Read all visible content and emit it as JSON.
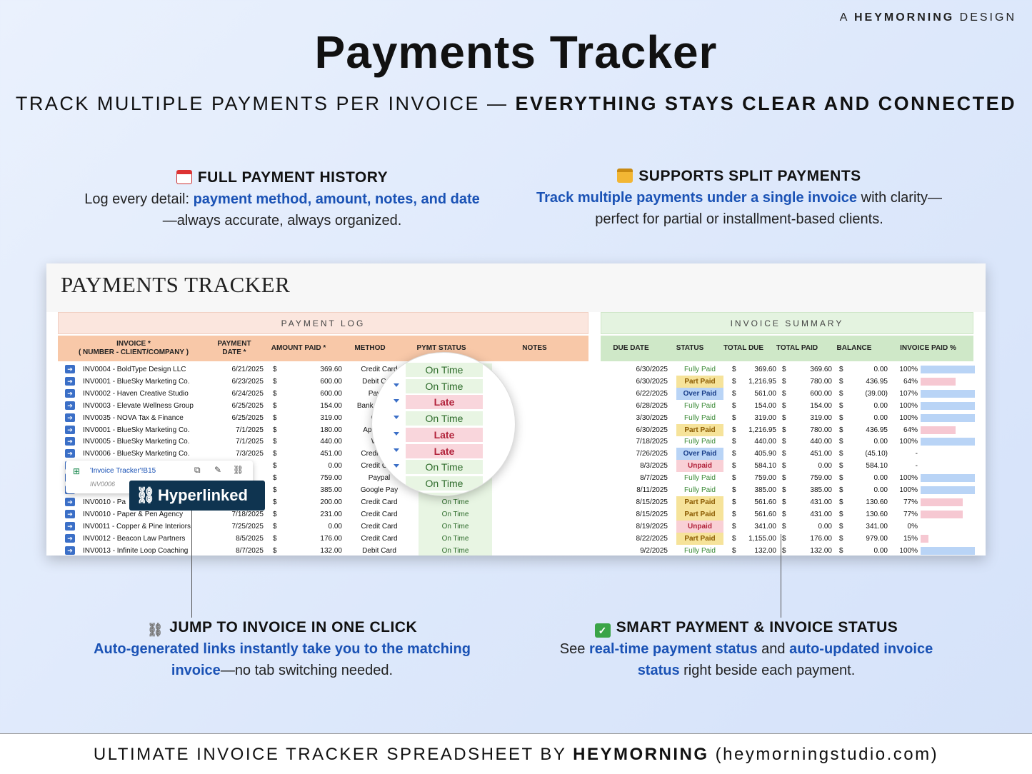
{
  "brand": {
    "prefix": "A",
    "name": "HEYMORNING",
    "suffix": "DESIGN"
  },
  "title": "Payments Tracker",
  "subtitle": {
    "normal": "TRACK MULTIPLE PAYMENTS PER INVOICE — ",
    "bold": "EVERYTHING STAYS CLEAR AND CONNECTED"
  },
  "features": {
    "history": {
      "icon": "calendar-icon",
      "heading": "FULL PAYMENT HISTORY",
      "t1": "Log every detail: ",
      "b1": "payment method, amount, notes, and date",
      "t2": "—always accurate, always organized."
    },
    "split": {
      "icon": "credit-card-icon",
      "heading": "SUPPORTS SPLIT PAYMENTS",
      "b1": "Track multiple payments under a single invoice",
      "t1": " with clarity—perfect for partial or installment-based clients."
    },
    "jump": {
      "icon": "link-icon",
      "heading": "JUMP TO INVOICE IN ONE CLICK",
      "b1": "Auto-generated links instantly take you to the matching invoice",
      "t1": "—no tab switching needed."
    },
    "status": {
      "icon": "check-icon",
      "heading": "SMART PAYMENT & INVOICE STATUS",
      "t1": "See ",
      "b1": "real-time payment status",
      "t2": " and ",
      "b2": "auto-updated invoice status",
      "t3": " right beside each payment."
    }
  },
  "sheet": {
    "title": "PAYMENTS TRACKER",
    "payment_log": "PAYMENT  LOG",
    "invoice_summary": "INVOICE  SUMMARY",
    "headers": {
      "invoice": "INVOICE *\n( NUMBER - CLIENT/COMPANY )",
      "pdate": "PAYMENT DATE *",
      "amount": "AMOUNT PAID *",
      "method": "METHOD",
      "pstatus": "PYMT STATUS",
      "notes": "NOTES",
      "due": "DUE DATE",
      "status": "STATUS",
      "tdue": "TOTAL DUE",
      "tpaid": "TOTAL PAID",
      "balance": "BALANCE",
      "pct": "INVOICE PAID %"
    },
    "rows": [
      {
        "inv": "INV0004 - BoldType Design LLC",
        "date": "6/21/2025",
        "amt": "369.60",
        "method": "Credit Card",
        "ps": "On Time",
        "due": "6/30/2025",
        "status": "Fully Paid",
        "tdue": "369.60",
        "tpaid": "369.60",
        "bal": "0.00",
        "pct": "100%",
        "p": 1.0
      },
      {
        "inv": "INV0001 - BlueSky Marketing Co.",
        "date": "6/23/2025",
        "amt": "600.00",
        "method": "Debit Card",
        "ps": "On Time",
        "due": "6/30/2025",
        "status": "Part Paid",
        "tdue": "1,216.95",
        "tpaid": "780.00",
        "bal": "436.95",
        "pct": "64%",
        "p": 0.64
      },
      {
        "inv": "INV0002 - Haven Creative Studio",
        "date": "6/24/2025",
        "amt": "600.00",
        "method": "Paypal",
        "ps": "Late",
        "due": "6/22/2025",
        "status": "Over Paid",
        "tdue": "561.00",
        "tpaid": "600.00",
        "bal": "(39.00)",
        "pct": "107%",
        "p": 1.0
      },
      {
        "inv": "INV0003 - Elevate Wellness Group",
        "date": "6/25/2025",
        "amt": "154.00",
        "method": "Bank Transfer",
        "ps": "On Time",
        "due": "6/28/2025",
        "status": "Fully Paid",
        "tdue": "154.00",
        "tpaid": "154.00",
        "bal": "0.00",
        "pct": "100%",
        "p": 1.0
      },
      {
        "inv": "INV0035 - NOVA Tax & Finance",
        "date": "6/25/2025",
        "amt": "319.00",
        "method": "Cash",
        "ps": "On Time",
        "due": "3/30/2025",
        "status": "Fully Paid",
        "tdue": "319.00",
        "tpaid": "319.00",
        "bal": "0.00",
        "pct": "100%",
        "p": 1.0
      },
      {
        "inv": "INV0001 - BlueSky Marketing Co.",
        "date": "7/1/2025",
        "amt": "180.00",
        "method": "Apple Pay",
        "ps": "Late",
        "due": "6/30/2025",
        "status": "Part Paid",
        "tdue": "1,216.95",
        "tpaid": "780.00",
        "bal": "436.95",
        "pct": "64%",
        "p": 0.64
      },
      {
        "inv": "INV0005 - BlueSky Marketing Co.",
        "date": "7/1/2025",
        "amt": "440.00",
        "method": "Wise",
        "ps": "Late",
        "due": "7/18/2025",
        "status": "Fully Paid",
        "tdue": "440.00",
        "tpaid": "440.00",
        "bal": "0.00",
        "pct": "100%",
        "p": 1.0
      },
      {
        "inv": "INV0006 - BlueSky Marketing Co.",
        "date": "7/3/2025",
        "amt": "451.00",
        "method": "Credit Card",
        "ps": "On Time",
        "due": "7/26/2025",
        "status": "Over Paid",
        "tdue": "405.90",
        "tpaid": "451.00",
        "bal": "(45.10)",
        "pct": "-",
        "p": 0
      },
      {
        "inv": "",
        "date": "",
        "amt": "0.00",
        "method": "Credit Card",
        "ps": "On Time",
        "due": "8/3/2025",
        "status": "Unpaid",
        "tdue": "584.10",
        "tpaid": "0.00",
        "bal": "584.10",
        "pct": "-",
        "p": 0
      },
      {
        "inv": "",
        "date": "",
        "amt": "759.00",
        "method": "Paypal",
        "ps": "On Time",
        "due": "8/7/2025",
        "status": "Fully Paid",
        "tdue": "759.00",
        "tpaid": "759.00",
        "bal": "0.00",
        "pct": "100%",
        "p": 1.0
      },
      {
        "inv": "",
        "date": "",
        "amt": "385.00",
        "method": "Google Pay",
        "ps": "On Time",
        "due": "8/11/2025",
        "status": "Fully Paid",
        "tdue": "385.00",
        "tpaid": "385.00",
        "bal": "0.00",
        "pct": "100%",
        "p": 1.0
      },
      {
        "inv": "INV0010 - Pa",
        "date": "",
        "amt": "200.00",
        "method": "Credit Card",
        "ps": "On Time",
        "due": "8/15/2025",
        "status": "Part Paid",
        "tdue": "561.60",
        "tpaid": "431.00",
        "bal": "130.60",
        "pct": "77%",
        "p": 0.77
      },
      {
        "inv": "INV0010 - Paper & Pen Agency",
        "date": "7/18/2025",
        "amt": "231.00",
        "method": "Credit Card",
        "ps": "On Time",
        "due": "8/15/2025",
        "status": "Part Paid",
        "tdue": "561.60",
        "tpaid": "431.00",
        "bal": "130.60",
        "pct": "77%",
        "p": 0.77
      },
      {
        "inv": "INV0011 - Copper & Pine Interiors",
        "date": "7/25/2025",
        "amt": "0.00",
        "method": "Credit Card",
        "ps": "On Time",
        "due": "8/19/2025",
        "status": "Unpaid",
        "tdue": "341.00",
        "tpaid": "0.00",
        "bal": "341.00",
        "pct": "0%",
        "p": 0
      },
      {
        "inv": "INV0012 - Beacon Law Partners",
        "date": "8/5/2025",
        "amt": "176.00",
        "method": "Credit Card",
        "ps": "On Time",
        "due": "8/22/2025",
        "status": "Part Paid",
        "tdue": "1,155.00",
        "tpaid": "176.00",
        "bal": "979.00",
        "pct": "15%",
        "p": 0.15
      },
      {
        "inv": "INV0013 - Infinite Loop Coaching",
        "date": "8/7/2025",
        "amt": "132.00",
        "method": "Debit Card",
        "ps": "On Time",
        "due": "9/2/2025",
        "status": "Fully Paid",
        "tdue": "132.00",
        "tpaid": "132.00",
        "bal": "0.00",
        "pct": "100%",
        "p": 1.0
      }
    ],
    "lens_items": [
      "On Time",
      "On Time",
      "Late",
      "On Time",
      "Late",
      "Late",
      "On Time",
      "On Time",
      "On Time"
    ],
    "tooltip": {
      "link": "'Invoice Tracker'!B15",
      "ref": "INV0006"
    },
    "badge": "Hyperlinked"
  },
  "footer": {
    "normal": "ULTIMATE INVOICE TRACKER SPREADSHEET BY ",
    "bold": "HEYMORNING",
    "tail": " (heymorningstudio.com)"
  },
  "colors": {
    "accent_blue": "#1a52b5",
    "late": "#b1223a",
    "ontime": "#2d6b2a"
  }
}
